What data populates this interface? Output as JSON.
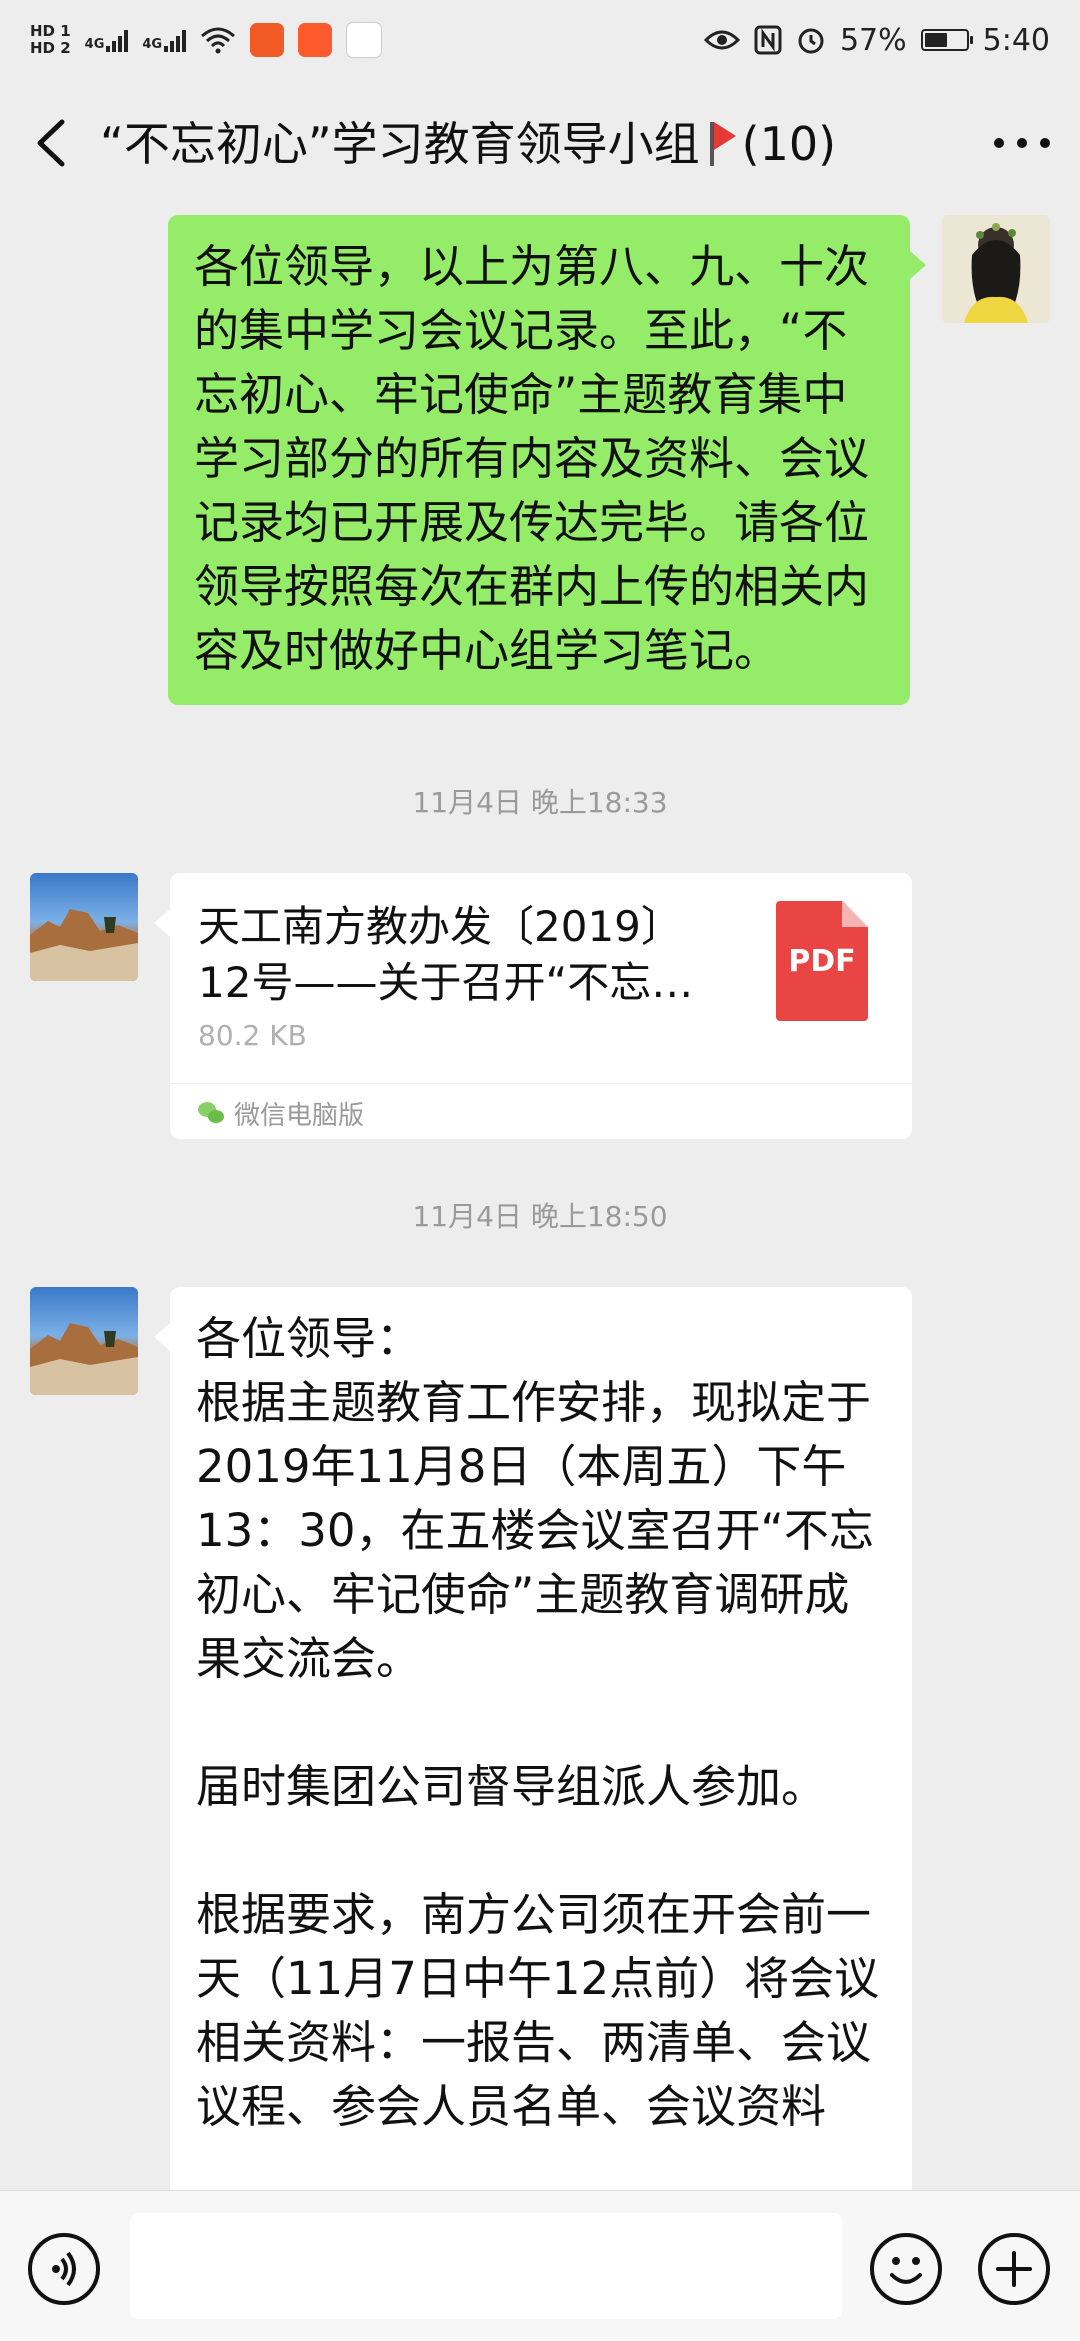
{
  "status_bar": {
    "hd1": "HD 1",
    "hd2": "HD 2",
    "net1": "4G",
    "net2": "4G",
    "battery_percent": "57%",
    "battery_level": 0.57,
    "time": "5:40"
  },
  "nav": {
    "title_before_flag": "“不忘初心”学习教育领导小组",
    "title_after_flag": "(10)"
  },
  "messages": {
    "self_text": "各位领导，以上为第八、九、十次的集中学习会议记录。至此，“不忘初心、牢记使命”主题教育集中学习部分的所有内容及资料、会议记录均已开展及传达完毕。请各位领导按照每次在群内上传的相关内容及时做好中心组学习笔记。",
    "timestamp_1": "11月4日 晚上18:33",
    "file": {
      "name_line1": "天工南方教办发〔2019〕",
      "name_line2": "12号——关于召开“不忘…",
      "size": "80.2 KB",
      "type_label": "PDF",
      "source": "微信电脑版"
    },
    "timestamp_2": "11月4日 晚上18:50",
    "long_message": {
      "greeting": "各位领导：",
      "para1": "根据主题教育工作安排，现拟定于2019年11月8日（本周五）下午13：30，在五楼会议室召开“不忘初心、牢记使命”主题教育调研成果交流会。",
      "para2": "届时集团公司督导组派人参加。",
      "para3": "根据要求，南方公司须在开会前一天（11月7日中午12点前）将会议相关资料：一报告、两清单、会议议程、参会人员名单、会议资料"
    }
  },
  "input_bar": {
    "placeholder": ""
  }
}
